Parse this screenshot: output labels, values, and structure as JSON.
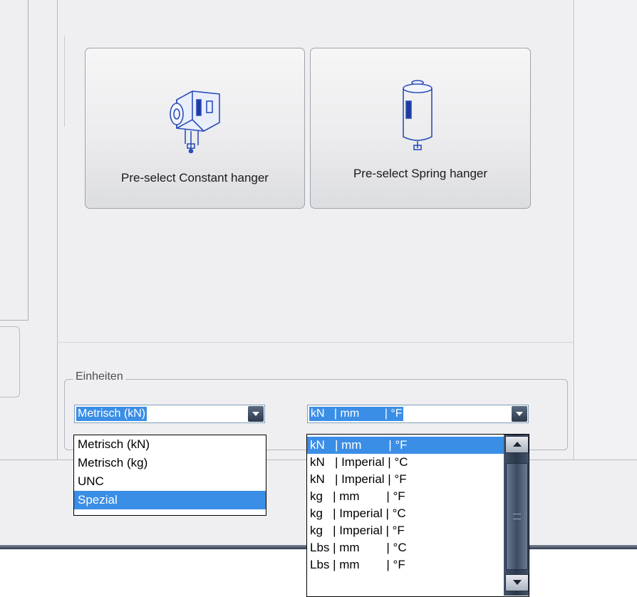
{
  "buttons": {
    "constant_hanger": "Pre-select Constant hanger",
    "spring_hanger": "Pre-select Spring hanger"
  },
  "units_group": {
    "title": "Einheiten",
    "system_combo": {
      "value": "Metrisch (kN)",
      "options": [
        "Metrisch (kN)",
        "Metrisch (kg)",
        "UNC",
        "Spezial"
      ],
      "highlighted": "Spezial"
    },
    "unit_combo": {
      "value": "kN   | mm        | °F",
      "options": [
        "kN   | mm        | °F",
        "kN   | Imperial | °C",
        "kN   | Imperial | °F",
        "kg   | mm        | °F",
        "kg   | Imperial | °C",
        "kg   | Imperial | °F",
        "Lbs | mm        | °C",
        "Lbs | mm        | °F"
      ],
      "highlighted": "kN   | mm        | °F"
    }
  },
  "icons": [
    "constant-hanger-icon",
    "spring-hanger-icon",
    "chevron-down-icon",
    "scroll-up-icon",
    "scroll-down-icon"
  ],
  "colors": {
    "selection": "#3b8ee6",
    "panel": "#efeff1",
    "scrollbar": "#2b3849"
  }
}
